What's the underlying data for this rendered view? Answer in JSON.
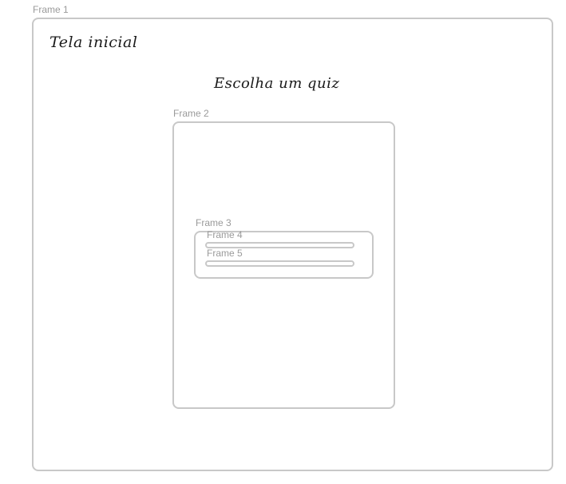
{
  "frames": {
    "frame1": {
      "label": "Frame 1"
    },
    "frame2": {
      "label": "Frame 2"
    },
    "frame3": {
      "label": "Frame 3"
    },
    "frame4": {
      "label": "Frame 4"
    },
    "frame5": {
      "label": "Frame 5"
    }
  },
  "screen": {
    "title": "Tela inicial",
    "heading": "Escolha um quiz"
  },
  "colors": {
    "frame_border": "#c8c8c8",
    "frame_label": "#9a9a9a",
    "text": "#1a1a1a"
  }
}
